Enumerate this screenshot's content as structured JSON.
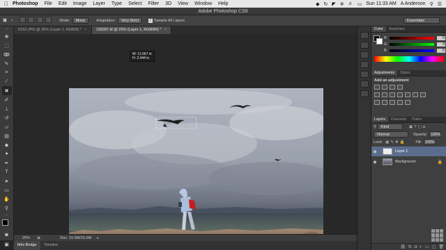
{
  "menubar": {
    "app_name": "Photoshop",
    "items": [
      "File",
      "Edit",
      "Image",
      "Layer",
      "Type",
      "Select",
      "Filter",
      "3D",
      "View",
      "Window",
      "Help"
    ],
    "clock": "Sun 11:33 AM",
    "user": "A Anderson"
  },
  "titlebar": {
    "title": "Adobe Photoshop CS6"
  },
  "options": {
    "mode_label": "Mode:",
    "mode_value": "Move",
    "adaptation_label": "Adaptation:",
    "adaptation_value": "Very Strict",
    "sample_all_label": "Sample All Layers",
    "workspace": "Essentials"
  },
  "tabs": [
    {
      "label": "0210.JPG @ 30% (Layer 1, RGB/8) *"
    },
    {
      "label": "139097.tif @ 25% (Layer 1, RGB/8#) *"
    }
  ],
  "infobox": {
    "w_label": "W:",
    "w_value": "11.667 in",
    "h_label": "H:",
    "h_value": "2.444 in"
  },
  "status": {
    "zoom": "25%",
    "doc": "Doc: 15.6M/15.6M"
  },
  "bottomtabs": {
    "minibridge": "Mini Bridge",
    "timeline": "Timeline"
  },
  "color_panel": {
    "tab_color": "Color",
    "tab_swatches": "Swatches",
    "r_label": "R",
    "g_label": "G",
    "b_label": "B",
    "r_value": "0",
    "g_value": "0",
    "b_value": "0"
  },
  "adjustments_panel": {
    "tab_adjustments": "Adjustments",
    "tab_styles": "Styles",
    "title": "Add an adjustment"
  },
  "layers_panel": {
    "tab_layers": "Layers",
    "tab_channels": "Channels",
    "tab_paths": "Paths",
    "kind": "Kind",
    "blend_mode": "Normal",
    "opacity_label": "Opacity:",
    "opacity_value": "100%",
    "lock_label": "Lock:",
    "fill_label": "Fill:",
    "fill_value": "100%",
    "layers": [
      {
        "name": "Layer 1"
      },
      {
        "name": "Background"
      }
    ]
  },
  "colors": {
    "accent_selected": "#5b6d8c",
    "panel_bg": "#3f3f3f"
  }
}
